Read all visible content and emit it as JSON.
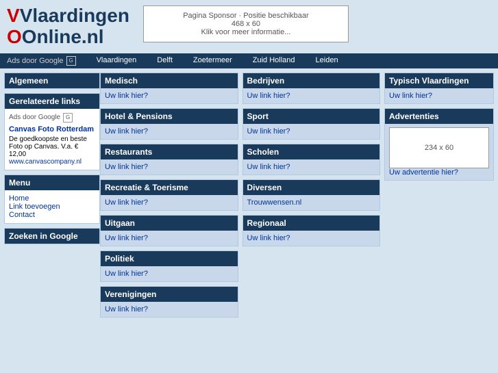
{
  "header": {
    "logo_line1": "Vlaardingen",
    "logo_line2": "Online.nl",
    "logo_v": "V",
    "logo_o": "O",
    "sponsor": {
      "line1": "Pagina Sponsor · Positie beschikbaar",
      "line2": "468 x 60",
      "line3": "Klik voor meer informatie..."
    }
  },
  "navbar": {
    "ads_label": "Ads door Google",
    "links": [
      "Vlaardingen",
      "Delft",
      "Zoetermeer",
      "Zuid Holland",
      "Leiden"
    ]
  },
  "sidebar": {
    "algemeen_header": "Algemeen",
    "gerelateerde_header": "Gerelateerde links",
    "ads_google_label": "Ads door Google",
    "ad_link1": "Canvas Foto Rotterdam",
    "ad_text": "De goedkoopste en beste Foto op Canvas. V.a. € 12,00",
    "ad_url": "www.canvascompany.nl",
    "menu_header": "Menu",
    "menu_items": [
      "Home",
      "Link toevoegen",
      "Contact"
    ],
    "zoeken_header": "Zoeken in Google"
  },
  "categories": {
    "col1": [
      {
        "header": "Medisch",
        "body": "Uw link hier?"
      },
      {
        "header": "Hotel & Pensions",
        "body": "Uw link hier?"
      },
      {
        "header": "Restaurants",
        "body": "Uw link hier?"
      },
      {
        "header": "Recreatie & Toerisme",
        "body": "Uw link hier?"
      },
      {
        "header": "Uitgaan",
        "body": "Uw link hier?"
      },
      {
        "header": "Politiek",
        "body": "Uw link hier?"
      },
      {
        "header": "Verenigingen",
        "body": "Uw link hier?"
      }
    ],
    "col2": [
      {
        "header": "Bedrijven",
        "body": "Uw link hier?"
      },
      {
        "header": "Sport",
        "body": "Uw link hier?"
      },
      {
        "header": "Scholen",
        "body": "Uw link hier?"
      },
      {
        "header": "Diversen",
        "body": "Trouwwensen.nl"
      },
      {
        "header": "Regionaal",
        "body": "Uw link hier?"
      }
    ],
    "col3": [
      {
        "header": "Typisch Vlaardingen",
        "body": "Uw link hier?"
      },
      {
        "header": "Advertenties",
        "body_ad": "234 x 60",
        "body_link": "Uw advertentie hier?"
      }
    ]
  }
}
